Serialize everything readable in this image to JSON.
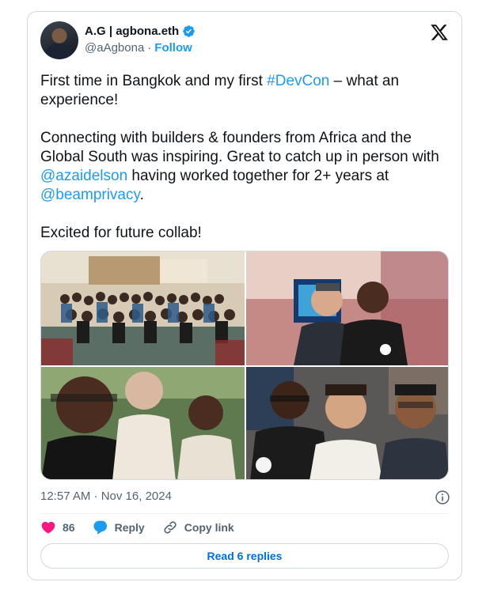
{
  "author": {
    "display_name": "A.G | agbona.eth",
    "handle": "@aAgbona",
    "separator": "·",
    "follow_label": "Follow",
    "avatar": "profile-photo"
  },
  "tweet": {
    "line1_prefix": "First time in Bangkok and my first ",
    "hashtag": "#DevCon",
    "line1_suffix": " – what an experience!",
    "para2_prefix": "Connecting with builders & founders from Africa and the Global South was inspiring. Great to catch up in person with ",
    "mention1": "@azaidelson",
    "para2_middle": " having worked together for 2+ years at ",
    "mention2": "@beamprivacy",
    "para2_suffix": ".",
    "para3": "Excited for future collab!"
  },
  "media": {
    "photos": [
      {
        "description": "group-photo-devcon-hall"
      },
      {
        "description": "selfie-two-men-event-booth"
      },
      {
        "description": "selfie-two-men-outdoors"
      },
      {
        "description": "selfie-three-men-venue"
      }
    ]
  },
  "meta": {
    "timestamp": "12:57 AM · Nov 16, 2024"
  },
  "actions": {
    "like_count": "86",
    "reply_label": "Reply",
    "copy_link_label": "Copy link"
  },
  "footer": {
    "read_replies_label": "Read 6 replies"
  },
  "colors": {
    "accent": "#1d9bf0",
    "like": "#f91880",
    "secondary_text": "#536471",
    "border": "#cfd9de"
  }
}
